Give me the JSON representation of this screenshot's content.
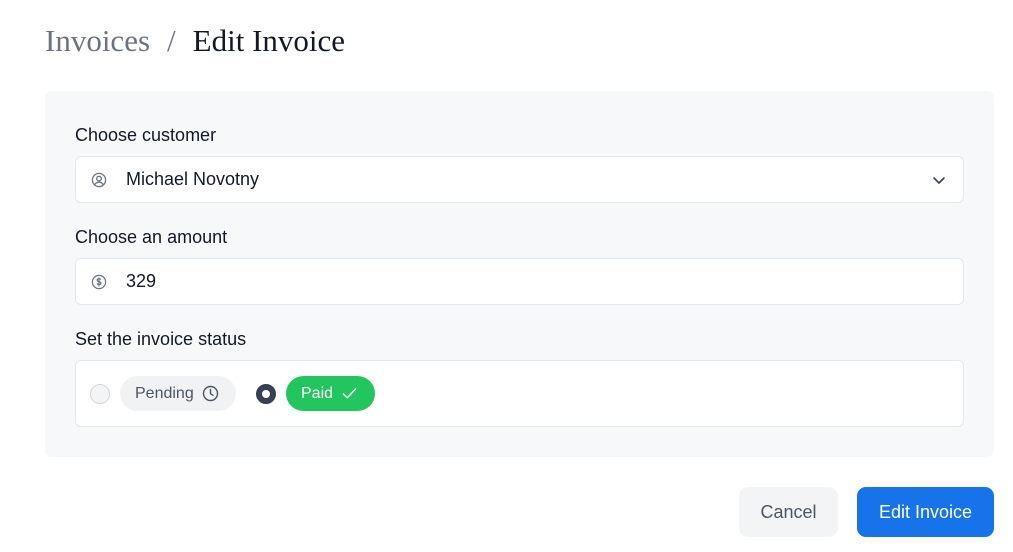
{
  "breadcrumb": {
    "parent": "Invoices",
    "separator": "/",
    "current": "Edit Invoice"
  },
  "form": {
    "customer": {
      "label": "Choose customer",
      "selected": "Michael Novotny",
      "icon": "user-circle-icon"
    },
    "amount": {
      "label": "Choose an amount",
      "value": "329",
      "icon": "dollar-circle-icon"
    },
    "status": {
      "label": "Set the invoice status",
      "options": [
        {
          "label": "Pending",
          "icon": "clock-icon",
          "checked": false
        },
        {
          "label": "Paid",
          "icon": "check-icon",
          "checked": true,
          "color": "#22c55e"
        }
      ]
    }
  },
  "actions": {
    "cancel_label": "Cancel",
    "submit_label": "Edit Invoice",
    "submit_color": "#1673ea"
  }
}
